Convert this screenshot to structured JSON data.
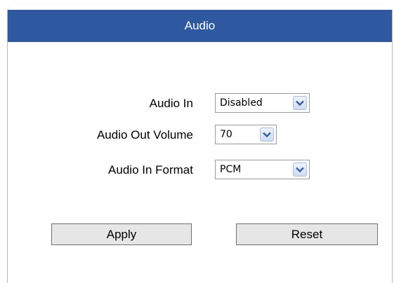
{
  "header": {
    "title": "Audio"
  },
  "fields": [
    {
      "label": "Audio In",
      "value": "Disabled"
    },
    {
      "label": "Audio Out Volume",
      "value": "70"
    },
    {
      "label": "Audio In Format",
      "value": "PCM"
    }
  ],
  "buttons": {
    "apply": "Apply",
    "reset": "Reset"
  },
  "colors": {
    "header_bg": "#2e59a0",
    "header_text": "#ffffff",
    "button_bg": "#e6e6e6"
  },
  "icons": {
    "dropdown": "chevron-down-icon"
  }
}
